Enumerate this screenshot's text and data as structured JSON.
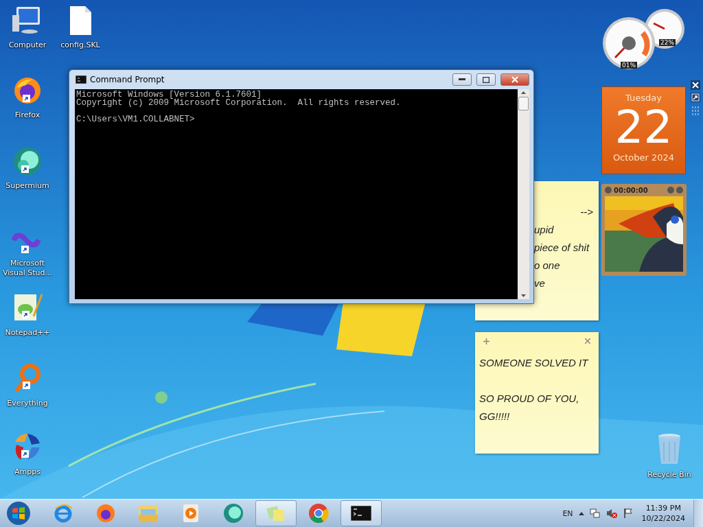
{
  "desktop_icons": [
    {
      "kind": "computer",
      "label": "Computer",
      "shortcut": false
    },
    {
      "kind": "file",
      "label": "config.SKL",
      "shortcut": false
    },
    {
      "kind": "firefox",
      "label": "Firefox",
      "shortcut": true
    },
    {
      "kind": "supermium",
      "label": "Supermium",
      "shortcut": true
    },
    {
      "kind": "vs",
      "label": "Microsoft Visual Stud...",
      "shortcut": true
    },
    {
      "kind": "notepad",
      "label": "Notepad++",
      "shortcut": true
    },
    {
      "kind": "everything",
      "label": "Everything",
      "shortcut": true
    },
    {
      "kind": "ampps",
      "label": "Ampps",
      "shortcut": true
    },
    {
      "kind": "recycle",
      "label": "Recycle Bin",
      "shortcut": false
    }
  ],
  "cmd_window": {
    "title": "Command Prompt",
    "lines": [
      "Microsoft Windows [Version 6.1.7601]",
      "Copyright (c) 2009 Microsoft Corporation.  All rights reserved."
    ],
    "prompt": "C:\\Users\\VM1.COLLABNET>"
  },
  "cpu_meter": {
    "cpu": "01%",
    "memory": "22%"
  },
  "calendar": {
    "weekday": "Tuesday",
    "day": "22",
    "month_year": "October 2024"
  },
  "slideshow": {
    "time": "00:00:00"
  },
  "sticky_notes": [
    {
      "paragraphs": [
        "-->",
        "upid",
        "piece of shit",
        "o one",
        "ve"
      ]
    },
    {
      "paragraphs": [
        "SOMEONE SOLVED IT",
        "SO PROUD OF YOU, GG!!!!!"
      ]
    }
  ],
  "taskbar": {
    "items": [
      {
        "kind": "ie",
        "active": false
      },
      {
        "kind": "firefox",
        "active": false
      },
      {
        "kind": "explorer",
        "active": false
      },
      {
        "kind": "media",
        "active": false
      },
      {
        "kind": "supermium",
        "active": false
      },
      {
        "kind": "notes",
        "active": true
      },
      {
        "kind": "chrome",
        "active": false
      },
      {
        "kind": "cmd",
        "active": true
      }
    ],
    "language": "EN",
    "time": "11:39 PM",
    "date": "10/22/2024"
  }
}
